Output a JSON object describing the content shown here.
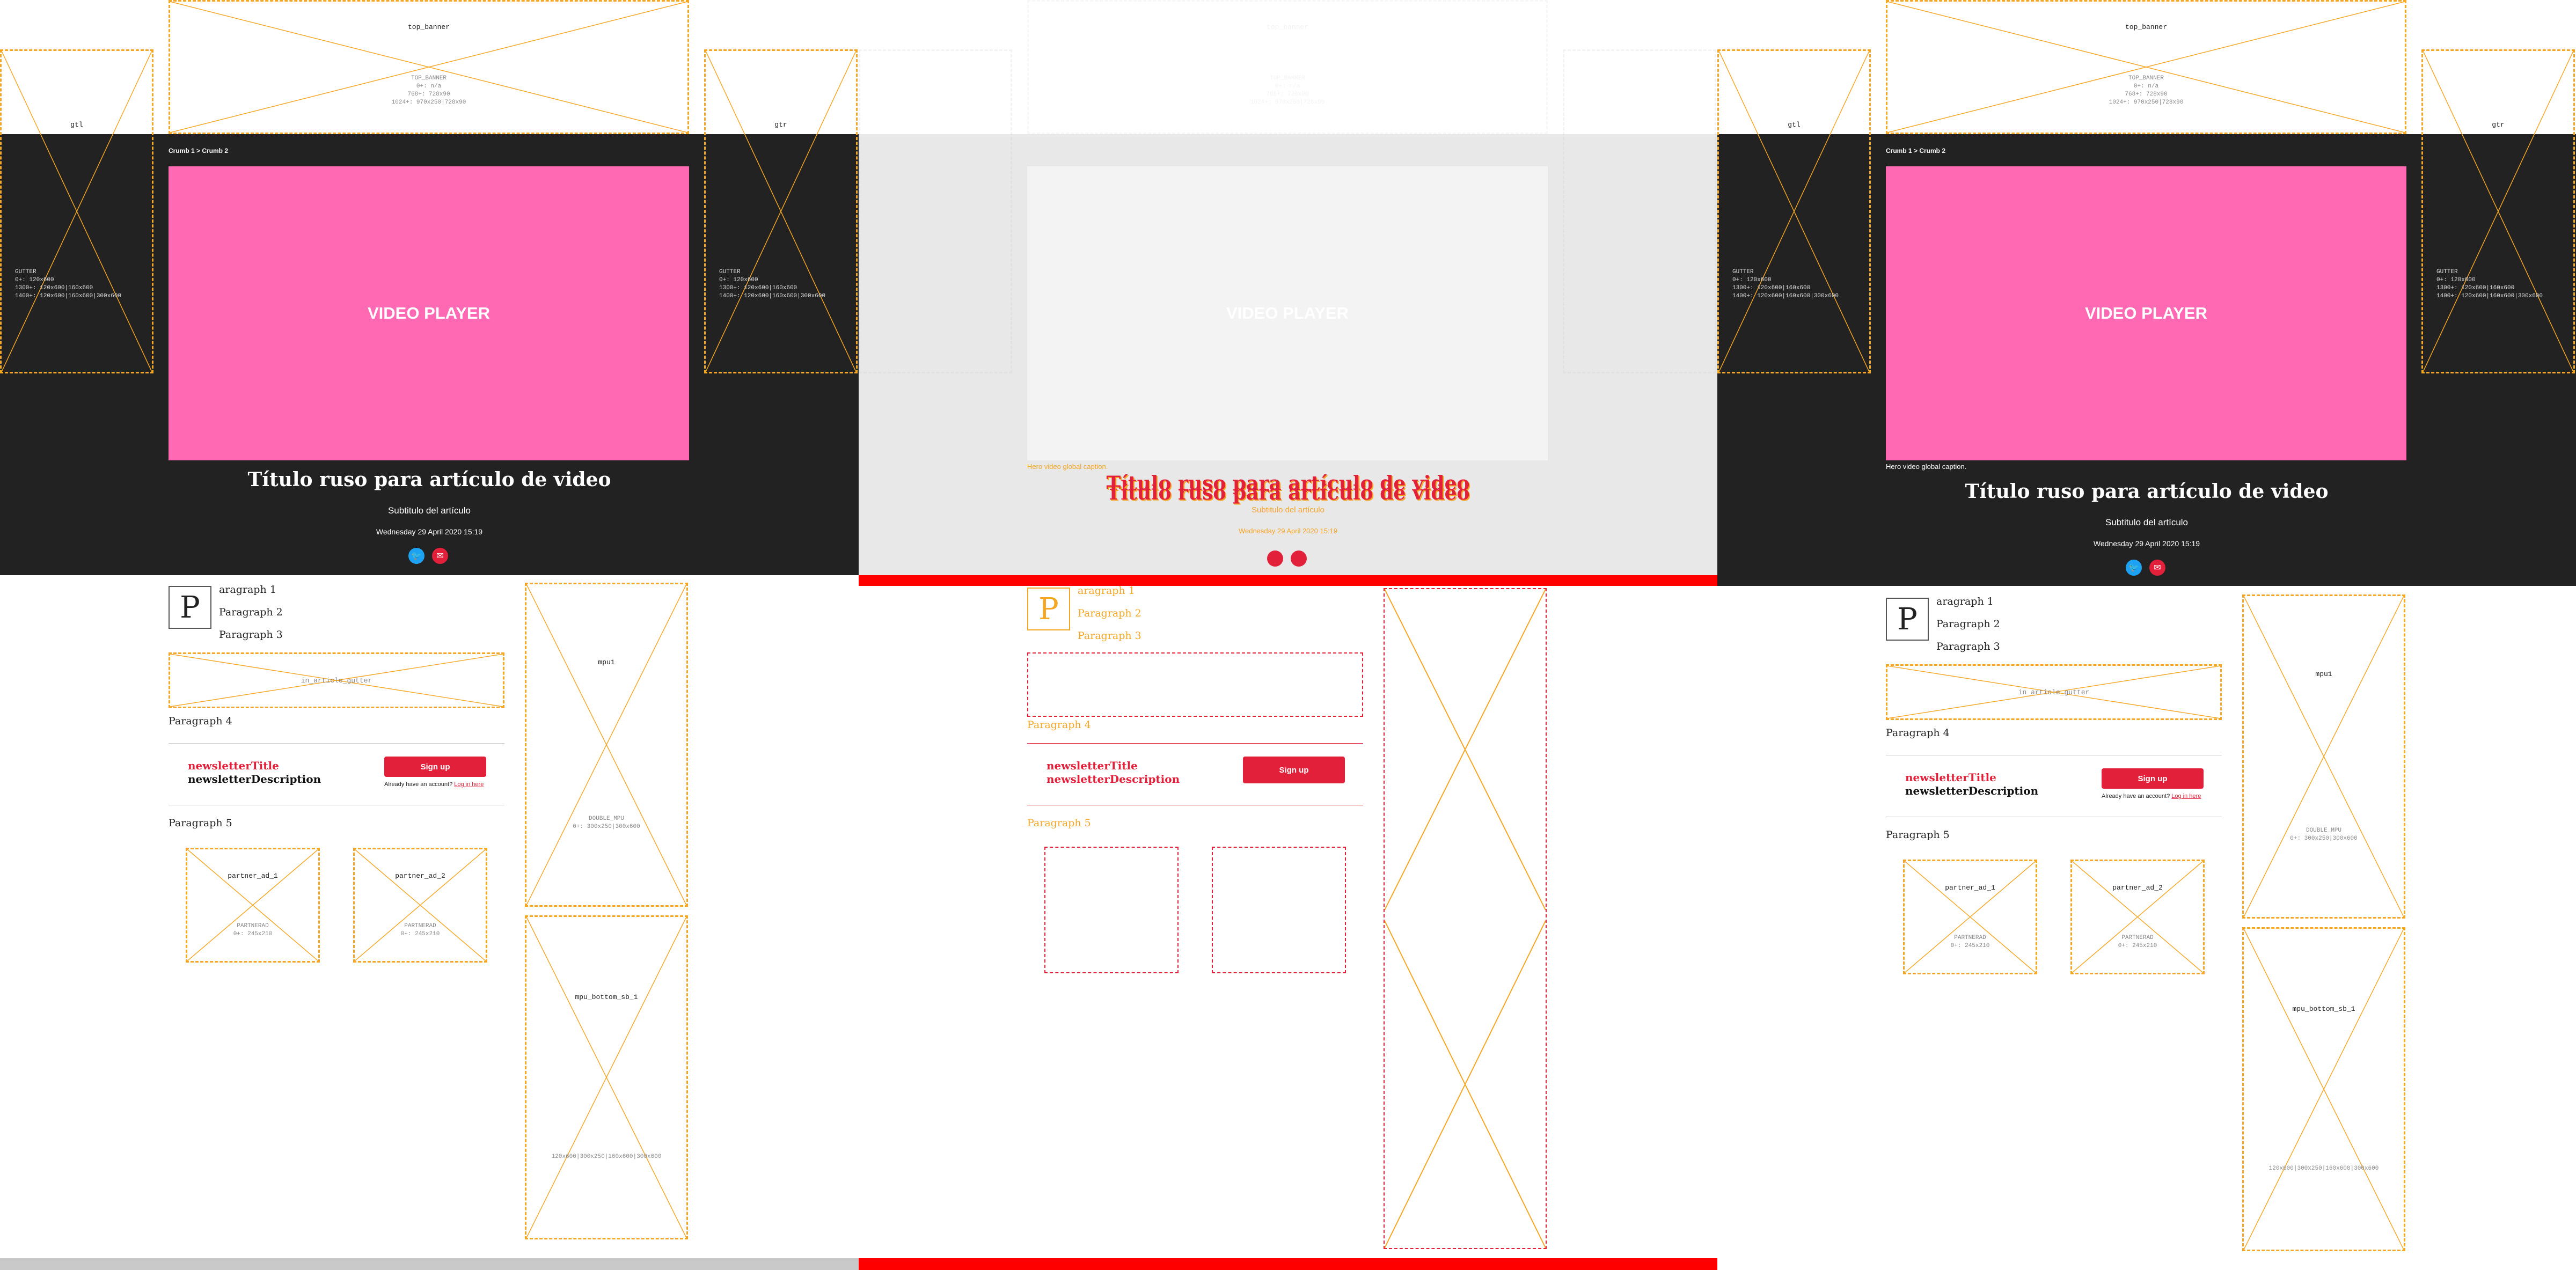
{
  "ads": {
    "top_banner": {
      "label": "top_banner",
      "meta": "TOP_BANNER\n0+: n/a\n768+: 728x90\n1024+: 970x250|728x90"
    },
    "gutter_left": {
      "label": "gtl",
      "meta": "GUTTER\n0+: 120x600\n1300+: 120x600|160x600\n1400+: 120x600|160x600|300x600"
    },
    "gutter_right": {
      "label": "gtr",
      "meta": "GUTTER\n0+: 120x600\n1300+: 120x600|160x600\n1400+: 120x600|160x600|300x600"
    },
    "in_article": {
      "label": "in_article_gutter"
    },
    "mpu": {
      "label": "mpu1",
      "meta": "DOUBLE_MPU\n0+: 300x250|300x600"
    },
    "mpu_bottom": {
      "label": "mpu_bottom_sb_1",
      "meta": "120x600|300x250|160x600|300x600"
    },
    "partner_1": {
      "label": "partner_ad_1",
      "meta": "PARTNERAD\n0+: 245x210"
    },
    "partner_2": {
      "label": "partner_ad_2",
      "meta": "PARTNERAD\n0+: 245x210"
    }
  },
  "article": {
    "breadcrumb": "Crumb 1 > Crumb 2",
    "video_label": "VIDEO PLAYER",
    "caption": "Hero video global caption.",
    "title": "Título ruso para artículo de video",
    "subtitle": "Subtitulo del artículo",
    "date": "Wednesday 29 April 2020 15:19",
    "dropcap": "P",
    "paragraphs": [
      "aragraph 1",
      "Paragraph 2",
      "Paragraph 3",
      "Paragraph 4",
      "Paragraph 5"
    ]
  },
  "share": {
    "twitter_icon": "twitter-icon",
    "email_icon": "email-icon"
  },
  "newsletter": {
    "title": "newsletterTitle",
    "description": "newsletterDescription",
    "signup_label": "Sign up",
    "already_text": "Already have an account?",
    "login_link": "Log in here"
  },
  "colors": {
    "accent": "#e3203a",
    "video": "#ff69b4",
    "dark": "#222222",
    "ad_outline": "#f5a623"
  }
}
